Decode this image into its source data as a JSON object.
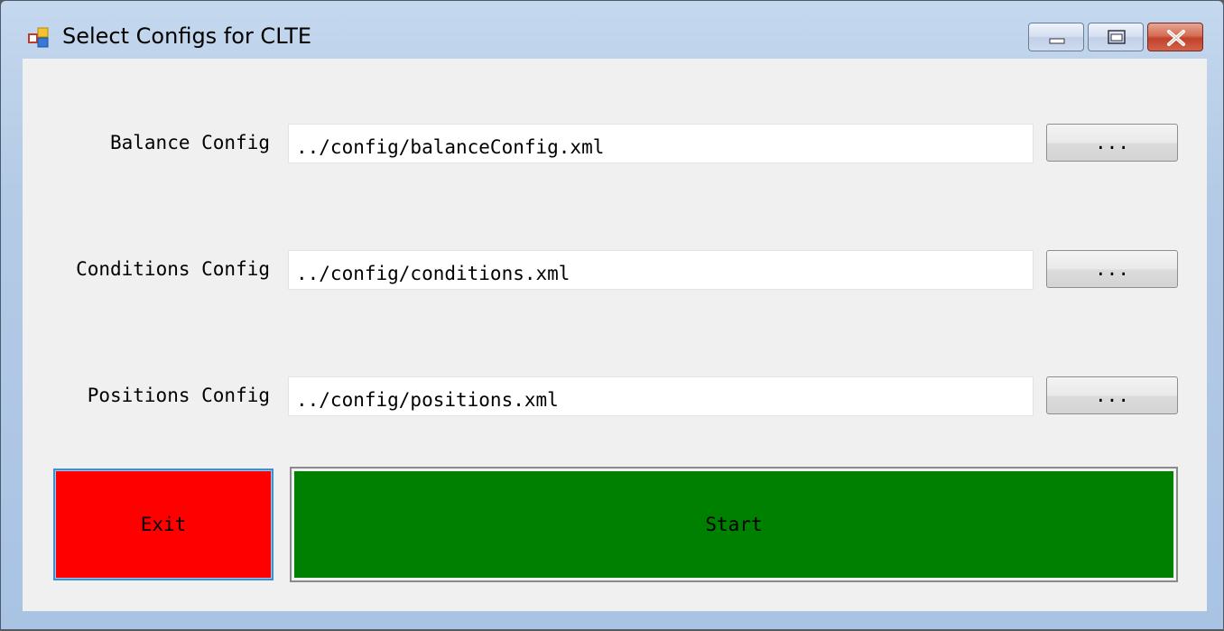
{
  "window": {
    "title": "Select Configs for CLTE",
    "controls": {
      "minimize": "minimize-icon",
      "maximize": "restore-icon",
      "close": "close-icon"
    }
  },
  "form": {
    "rows": [
      {
        "label": "Balance Config",
        "value": "../config/balanceConfig.xml",
        "browse_label": "..."
      },
      {
        "label": "Conditions Config",
        "value": "../config/conditions.xml",
        "browse_label": "..."
      },
      {
        "label": "Positions Config",
        "value": "../config/positions.xml",
        "browse_label": "..."
      }
    ],
    "exit_label": "Exit",
    "start_label": "Start"
  },
  "colors": {
    "exit": "#ff0000",
    "start": "#008000",
    "client_bg": "#f0f0f0"
  }
}
